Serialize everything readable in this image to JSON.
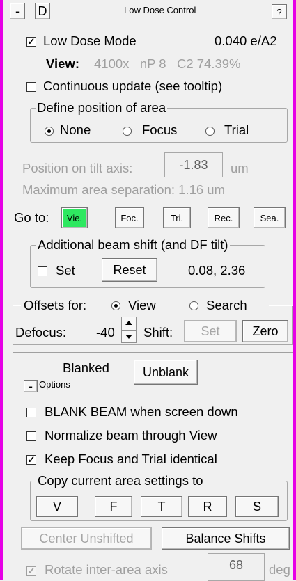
{
  "header": {
    "collapse_label": "-",
    "d_label": "D",
    "title": "Low Dose Control",
    "help_label": "?"
  },
  "low_dose": {
    "label": "Low Dose Mode",
    "checked": true,
    "dose": "0.040 e/A2"
  },
  "view_info": {
    "label": "View:",
    "values": "4100x   nP 8   C2 74.39%"
  },
  "continuous": {
    "label": "Continuous update (see tooltip)",
    "checked": false
  },
  "define_position": {
    "legend": "Define position of area",
    "options": [
      "None",
      "Focus",
      "Trial"
    ],
    "selected": "None"
  },
  "position_tilt": {
    "label": "Position on tilt axis:",
    "value": "-1.83",
    "unit": "um"
  },
  "max_separation": {
    "label": "Maximum area separation:  1.16 um"
  },
  "goto": {
    "label": "Go to:",
    "buttons": [
      "Vie.",
      "Foc.",
      "Tri.",
      "Rec.",
      "Sea."
    ],
    "active": "Vie."
  },
  "beam_shift": {
    "legend": "Additional beam shift (and DF tilt)",
    "set_label": "Set",
    "set_checked": false,
    "reset_label": "Reset",
    "value": "0.08, 2.36"
  },
  "offsets": {
    "label": "Offsets for:",
    "options": [
      "View",
      "Search"
    ],
    "selected": "View",
    "defocus_label": "Defocus:",
    "defocus_value": "-40",
    "shift_label": "Shift:",
    "set_label": "Set",
    "zero_label": "Zero"
  },
  "blank": {
    "status": "Blanked",
    "unblank_label": "Unblank",
    "options_collapse": "-",
    "options_label": "Options"
  },
  "options": [
    {
      "label": "BLANK BEAM when screen down",
      "checked": false
    },
    {
      "label": "Normalize beam through View",
      "checked": false
    },
    {
      "label": "Keep Focus and Trial identical",
      "checked": true
    }
  ],
  "copy": {
    "legend": "Copy current area settings to",
    "buttons": [
      "V",
      "F",
      "T",
      "R",
      "S"
    ]
  },
  "center_unshifted_label": "Center Unshifted",
  "balance_shifts_label": "Balance Shifts",
  "rotate": {
    "label": "Rotate inter-area axis",
    "checked": true,
    "value": "68",
    "unit": "deg"
  },
  "check_mark": "✓"
}
